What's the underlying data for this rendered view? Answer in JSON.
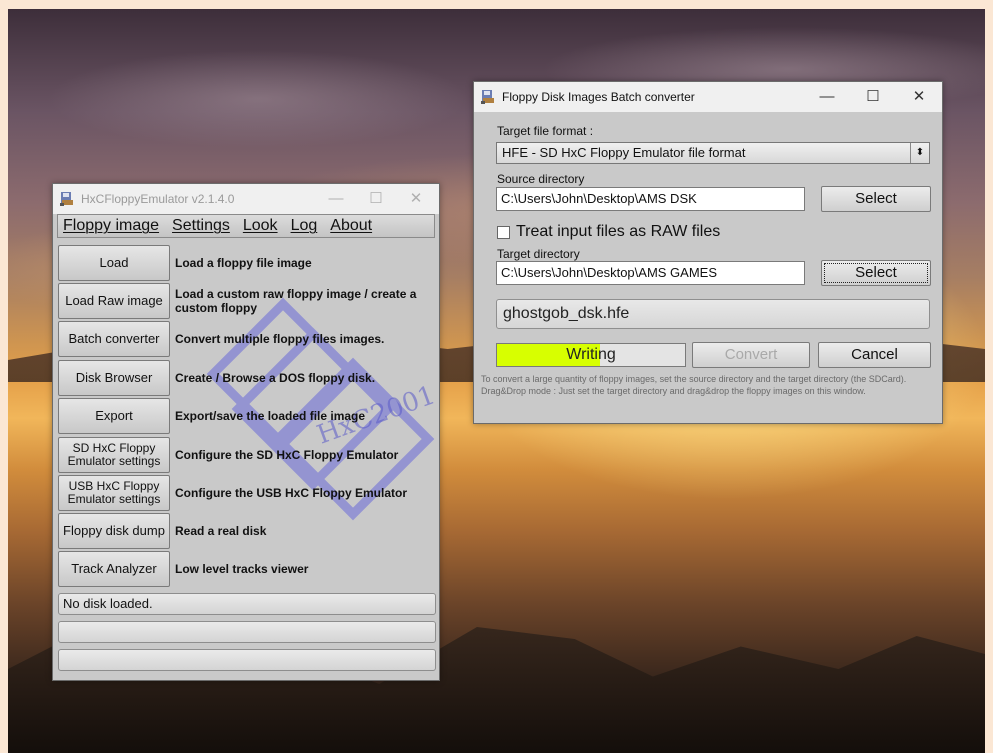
{
  "hxc_window": {
    "title": "HxCFloppyEmulator v2.1.4.0",
    "controls": {
      "minimize": "—",
      "maximize": "☐",
      "close": "✕"
    },
    "menu": [
      "Floppy image",
      "Settings",
      "Look",
      "Log",
      "About"
    ],
    "actions": [
      {
        "button": "Load",
        "desc": "Load a floppy file image"
      },
      {
        "button": "Load Raw image",
        "desc": "Load a custom raw floppy image / create a custom floppy"
      },
      {
        "button": "Batch converter",
        "desc": "Convert multiple floppy files images."
      },
      {
        "button": "Disk Browser",
        "desc": "Create / Browse a DOS floppy disk."
      },
      {
        "button": "Export",
        "desc": "Export/save the loaded file image"
      },
      {
        "button": "SD HxC Floppy Emulator settings",
        "desc": "Configure the SD HxC Floppy Emulator"
      },
      {
        "button": "USB HxC Floppy Emulator settings",
        "desc": "Configure the USB HxC Floppy Emulator"
      },
      {
        "button": "Floppy disk dump",
        "desc": "Read a real disk"
      },
      {
        "button": "Track Analyzer",
        "desc": "Low level tracks viewer"
      }
    ],
    "status": [
      "No disk loaded.",
      "",
      ""
    ],
    "watermark_text": "HxC2001"
  },
  "batch_window": {
    "title": "Floppy Disk Images Batch converter",
    "controls": {
      "minimize": "—",
      "maximize": "☐",
      "close": "✕"
    },
    "target_format_label": "Target file format :",
    "target_format_value": "HFE - SD HxC Floppy Emulator file format",
    "select_arrow": "⬍",
    "source_dir_label": "Source directory",
    "source_dir_value": "C:\\Users\\John\\Desktop\\AMS DSK",
    "select_label": "Select",
    "raw_checkbox_label": "Treat input files as RAW files",
    "raw_checked": false,
    "target_dir_label": "Target directory",
    "target_dir_value": "C:\\Users\\John\\Desktop\\AMS GAMES",
    "current_file": "ghostgob_dsk.hfe",
    "progress_text": "Writing",
    "progress_fraction": 0.55,
    "progress_color": "#d7ff00",
    "convert_label": "Convert",
    "cancel_label": "Cancel",
    "help_text": "To convert a large quantity of floppy images, set the source directory and the target directory (the SDCard). Drag&Drop mode : Just set the target directory and drag&drop the floppy images on this window."
  }
}
